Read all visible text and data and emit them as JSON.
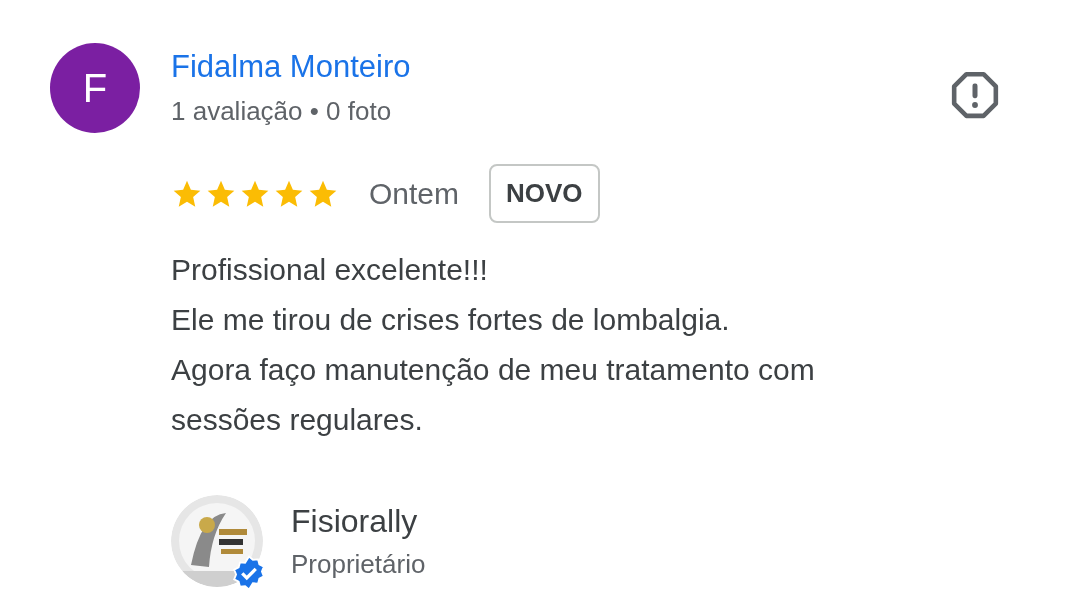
{
  "reviewer": {
    "initial": "F",
    "name": "Fidalma Monteiro",
    "meta": "1 avaliação • 0 foto"
  },
  "rating": {
    "stars": 5
  },
  "date": "Ontem",
  "badge": "NOVO",
  "review_text": "Profissional excelente!!!\nEle me tirou de crises fortes de lombalgia.\nAgora faço manutenção de meu tratamento com sessões regulares.",
  "owner": {
    "name": "Fisiorally",
    "role": "Proprietário",
    "verified": true
  }
}
